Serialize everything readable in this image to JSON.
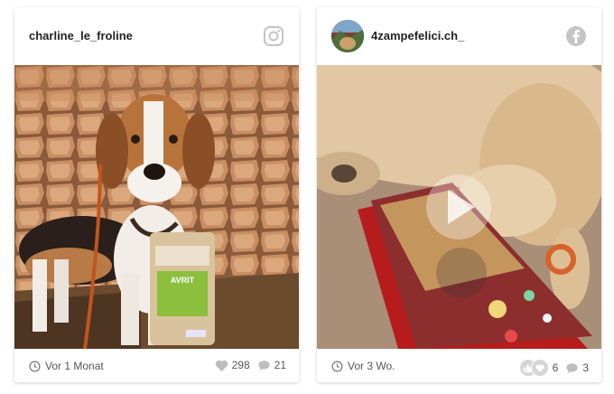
{
  "posts": [
    {
      "username": "charline_le_froline",
      "network_icon": "instagram-icon",
      "time": "Vor 1 Monat",
      "likes": "298",
      "comments": "21",
      "product_label": "AVRIT"
    },
    {
      "username": "4zampefelici.ch_",
      "network_icon": "facebook-icon",
      "time": "Vor 3 Wo.",
      "reactions": "6",
      "comments": "3"
    }
  ],
  "colors": {
    "icon_gray": "#c4c4c4",
    "text_dark": "#222222",
    "text_muted": "#555555"
  }
}
